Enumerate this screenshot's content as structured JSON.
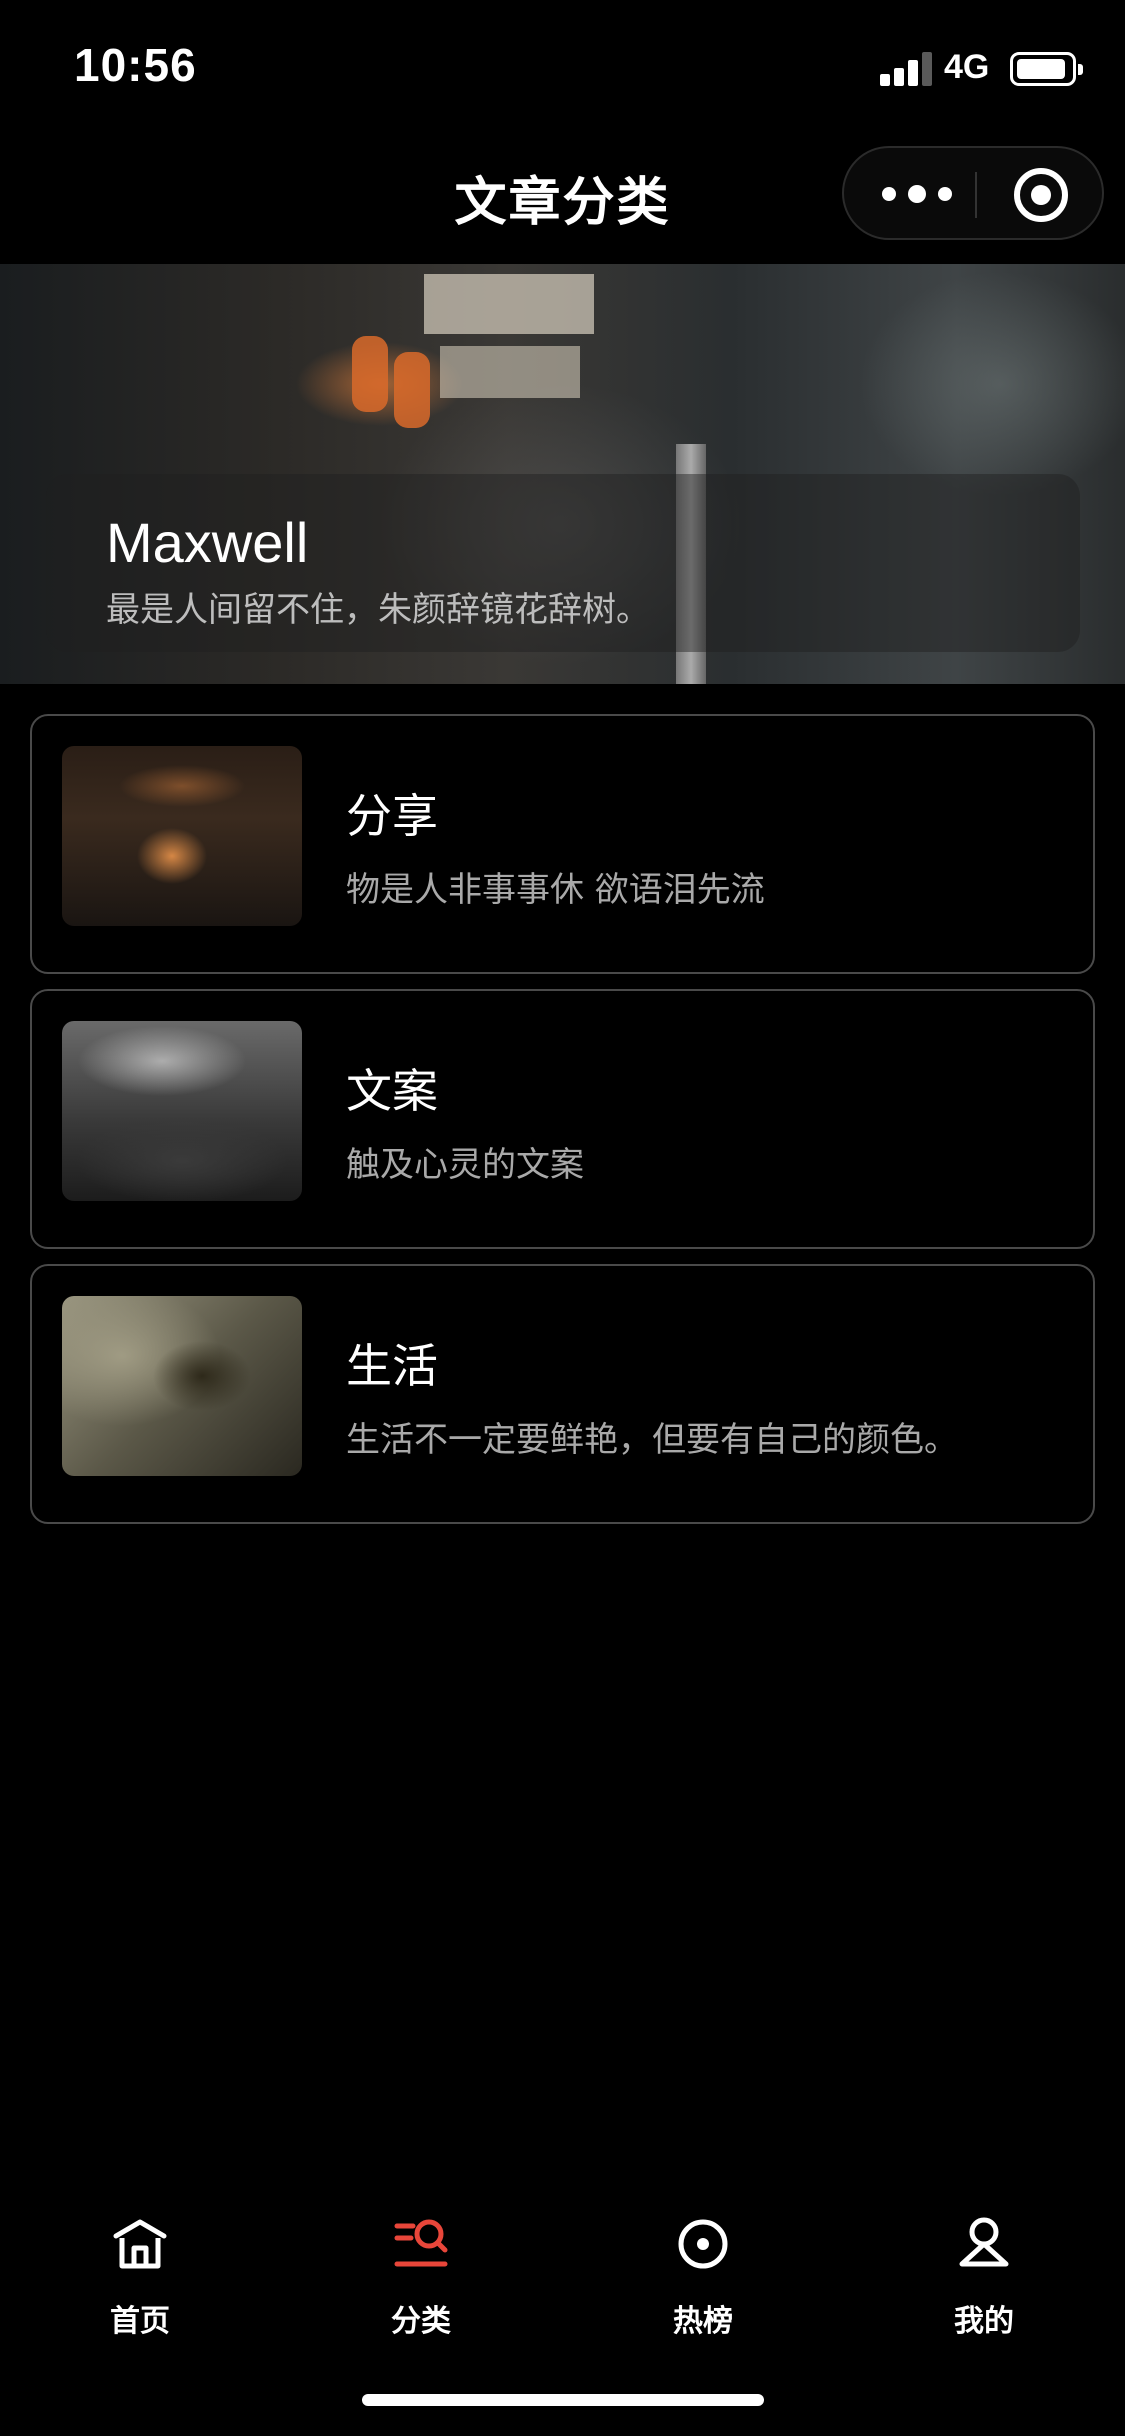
{
  "status_bar": {
    "time": "10:56",
    "network": "4G"
  },
  "nav": {
    "title": "文章分类"
  },
  "profile": {
    "name": "Maxwell",
    "motto": "最是人间留不住，朱颜辞镜花辞树。"
  },
  "categories": [
    {
      "title": "分享",
      "desc": "物是人非事事休 欲语泪先流"
    },
    {
      "title": "文案",
      "desc": "触及心灵的文案"
    },
    {
      "title": "生活",
      "desc": "生活不一定要鲜艳，但要有自己的颜色。"
    }
  ],
  "tabbar": {
    "items": [
      {
        "label": "首页",
        "icon": "home-icon"
      },
      {
        "label": "分类",
        "icon": "category-search-icon",
        "active": true
      },
      {
        "label": "热榜",
        "icon": "target-icon"
      },
      {
        "label": "我的",
        "icon": "user-icon"
      }
    ]
  },
  "colors": {
    "background": "#000000",
    "accent": "#e8463a",
    "text": "#ffffff",
    "muted": "#a9a9a9",
    "card_border": "#4a4a4a"
  }
}
